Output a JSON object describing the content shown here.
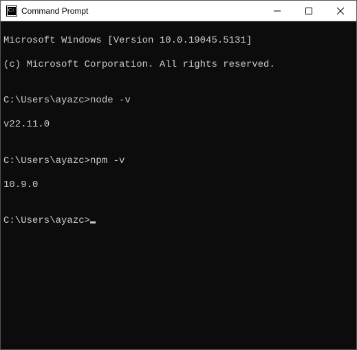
{
  "window": {
    "title": "Command Prompt"
  },
  "terminal": {
    "line1": "Microsoft Windows [Version 10.0.19045.5131]",
    "line2": "(c) Microsoft Corporation. All rights reserved.",
    "blank1": "",
    "prompt1": "C:\\Users\\ayazc>",
    "cmd1": "node -v",
    "out1": "v22.11.0",
    "blank2": "",
    "prompt2": "C:\\Users\\ayazc>",
    "cmd2": "npm -v",
    "out2": "10.9.0",
    "blank3": "",
    "prompt3": "C:\\Users\\ayazc>"
  }
}
